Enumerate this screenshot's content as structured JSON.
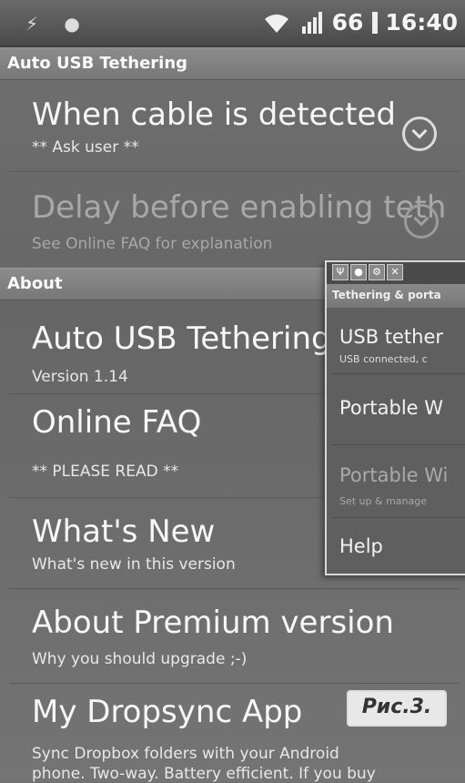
{
  "status_bar": {
    "battery": "66",
    "time": "16:40",
    "icons": [
      "usb-icon",
      "android-icon",
      "wifi-icon",
      "signal-icon"
    ]
  },
  "app_title": "Auto USB Tethering",
  "settings": [
    {
      "title": "When cable is detected",
      "summary": "** Ask user **",
      "enabled": true
    },
    {
      "title": "Delay before enabling teth",
      "summary": "See Online FAQ for explanation",
      "enabled": false
    }
  ],
  "about_header": "About",
  "about_items": [
    {
      "title": "Auto USB Tethering",
      "summary": "Version 1.14"
    },
    {
      "title": "Online FAQ",
      "summary": "** PLEASE READ **"
    },
    {
      "title": "What's New",
      "summary": "What's new in this version"
    },
    {
      "title": "About Premium version",
      "summary": "Why you should upgrade ;-)"
    },
    {
      "title": "My Dropsync App",
      "summary": "Sync Dropbox folders with your Android",
      "summary2": "phone. Two-way. Battery efficient. If you buy"
    }
  ],
  "overlay": {
    "header": "Tethering & porta",
    "items": [
      {
        "title": "USB tether",
        "summary": "USB connected, c"
      },
      {
        "title": "Portable W",
        "summary": ""
      },
      {
        "title": "Portable Wi",
        "summary": "Set up & manage"
      },
      {
        "title": "Help",
        "summary": ""
      }
    ]
  },
  "figure_label": "Рис.3."
}
